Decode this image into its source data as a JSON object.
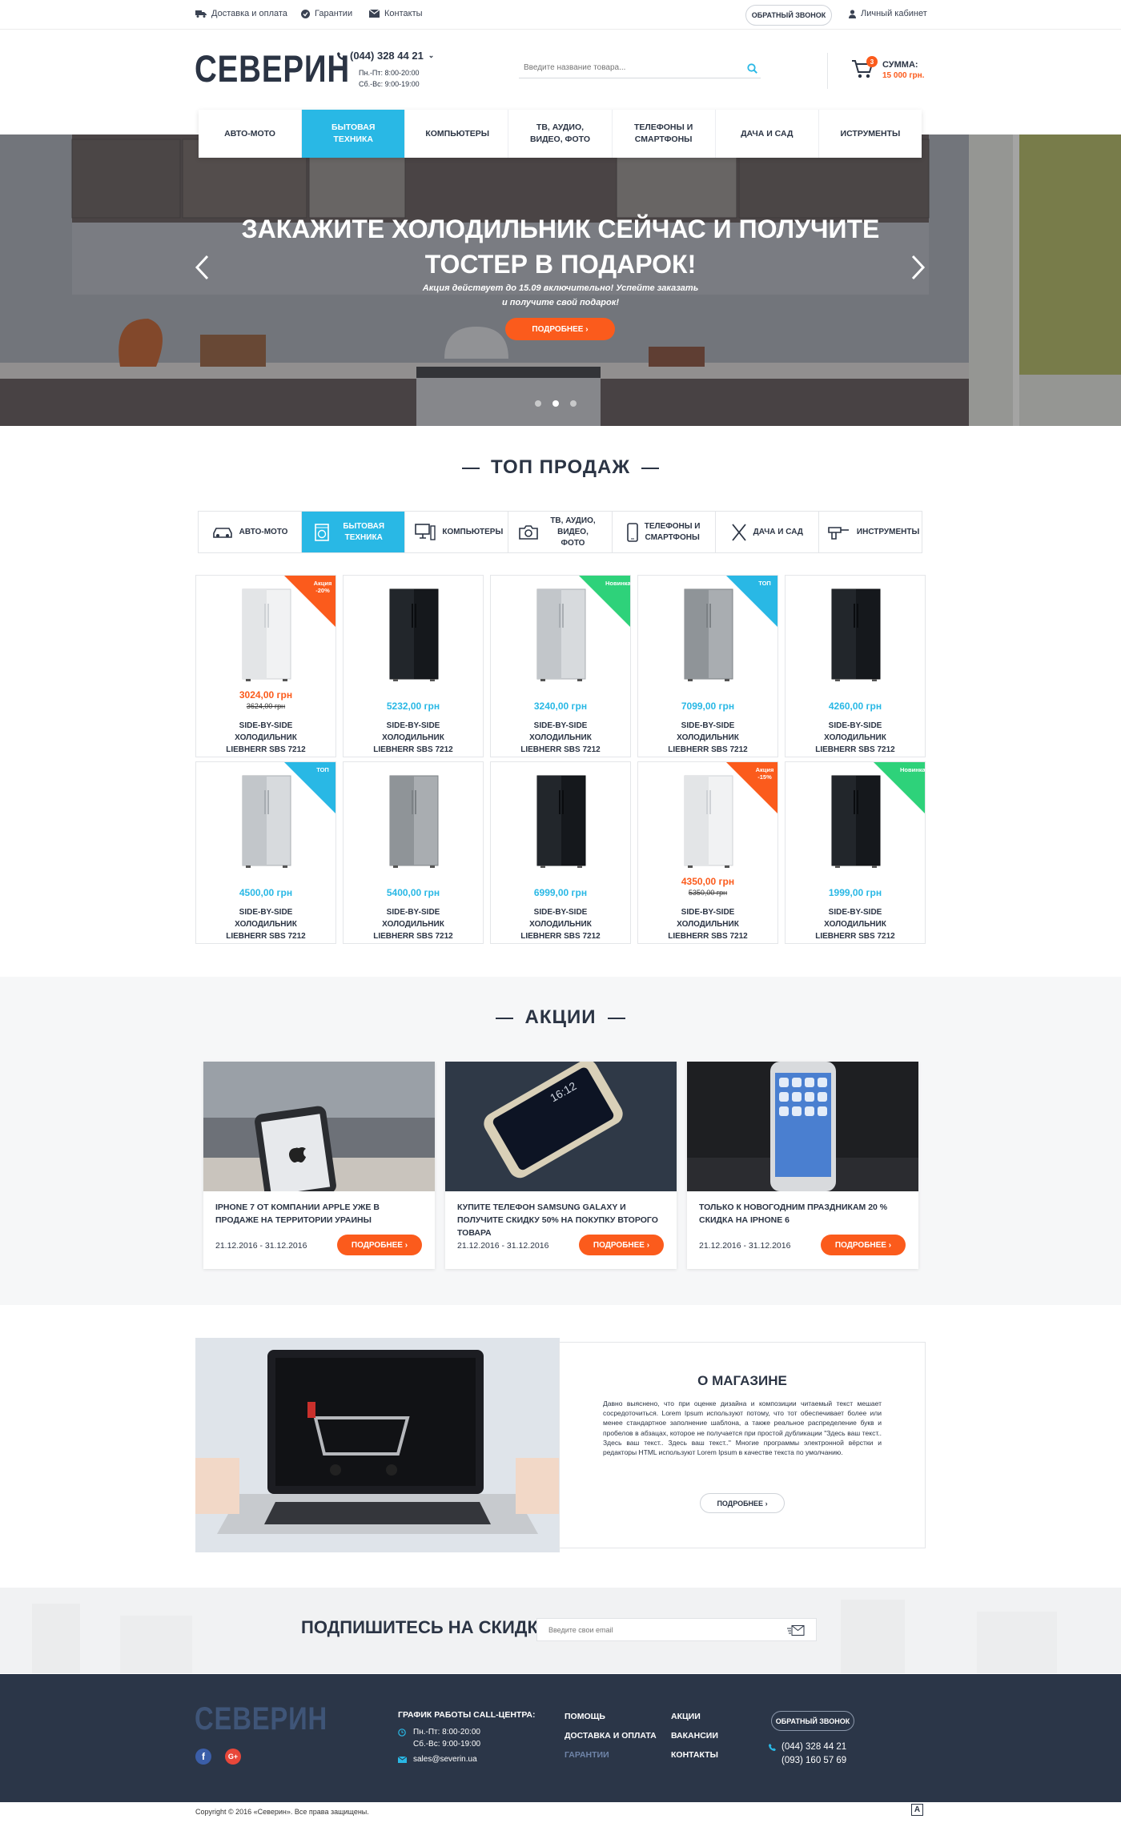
{
  "topbar": {
    "delivery": "Доставка и оплата",
    "guarantee": "Гарантии",
    "contacts": "Контакты",
    "callback": "Обратный звонок",
    "account": "Личный кабинет"
  },
  "header": {
    "logo": "СЕВЕРИН",
    "phone": "(044) 328 44 21",
    "hours_weekdays": "Пн.-Пт: 8:00-20:00",
    "hours_weekend": "Сб.-Вс: 9:00-19:00",
    "search_placeholder": "Введите название товара...",
    "cart_count": "3",
    "cart_label": "СУММА:",
    "cart_sum": "15 000 грн."
  },
  "nav": [
    {
      "label": "Авто-мото",
      "active": false
    },
    {
      "label": "Бытовая техника",
      "active": true
    },
    {
      "label": "Компьютеры",
      "active": false
    },
    {
      "label": "ТВ, Аудио, видео, фото",
      "active": false
    },
    {
      "label": "Телефоны и смартфоны",
      "active": false
    },
    {
      "label": "Дача и сад",
      "active": false
    },
    {
      "label": "Иструменты",
      "active": false
    }
  ],
  "hero": {
    "title_line1": "ЗАКАЖИТЕ ХОЛОДИЛЬНИК СЕЙЧАС И ПОЛУЧИТЕ",
    "title_line2": "ТОСТЕР В ПОДАРОК!",
    "sub_line1": "Акция действует до 15.09 включительно! Успейте заказать",
    "sub_line2": "и получите свой подарок!",
    "button": "Подробнее",
    "active_dot": 1,
    "dots": 3
  },
  "top_sales": {
    "title": "ТОП ПРОДАЖ",
    "tabs": [
      {
        "label": "Авто-мото",
        "icon": "car-icon",
        "active": false
      },
      {
        "label": "Бытовая техника",
        "icon": "washing-machine-icon",
        "active": true
      },
      {
        "label": "Компьютеры",
        "icon": "computer-icon",
        "active": false
      },
      {
        "label": "ТВ, аудио, видео, фото",
        "icon": "camera-icon",
        "active": false
      },
      {
        "label": "Телефоны и смартфоны",
        "icon": "phone-icon",
        "active": false
      },
      {
        "label": "Дача и сад",
        "icon": "garden-tools-icon",
        "active": false
      },
      {
        "label": "Инструменты",
        "icon": "drill-icon",
        "active": false
      }
    ],
    "products": [
      {
        "price": "3024,00 грн",
        "old": "3624,00 грн",
        "name": "SIDE-BY-SIDE ХОЛОДИЛЬНИК LIEBHERR SBS 7212",
        "badge": "Акция -20%",
        "badge_color": "#fb5b1c",
        "fridge": "white"
      },
      {
        "price": "5232,00 грн",
        "old": "",
        "name": "SIDE-BY-SIDE ХОЛОДИЛЬНИК LIEBHERR SBS 7212",
        "badge": "",
        "badge_color": "",
        "fridge": "black"
      },
      {
        "price": "3240,00 грн",
        "old": "",
        "name": "SIDE-BY-SIDE ХОЛОДИЛЬНИК LIEBHERR SBS 7212",
        "badge": "Новинка",
        "badge_color": "#2ed27a",
        "fridge": "silver"
      },
      {
        "price": "7099,00 грн",
        "old": "",
        "name": "SIDE-BY-SIDE ХОЛОДИЛЬНИК LIEBHERR SBS 7212",
        "badge": "ТОП",
        "badge_color": "#29b8e5",
        "fridge": "steel"
      },
      {
        "price": "4260,00 грн",
        "old": "",
        "name": "SIDE-BY-SIDE ХОЛОДИЛЬНИК LIEBHERR SBS 7212",
        "badge": "",
        "badge_color": "",
        "fridge": "black"
      },
      {
        "price": "4500,00 грн",
        "old": "",
        "name": "SIDE-BY-SIDE ХОЛОДИЛЬНИК LIEBHERR SBS 7212",
        "badge": "ТОП",
        "badge_color": "#29b8e5",
        "fridge": "silver"
      },
      {
        "price": "5400,00 грн",
        "old": "",
        "name": "SIDE-BY-SIDE ХОЛОДИЛЬНИК LIEBHERR SBS 7212",
        "badge": "",
        "badge_color": "",
        "fridge": "steel"
      },
      {
        "price": "6999,00 грн",
        "old": "",
        "name": "SIDE-BY-SIDE ХОЛОДИЛЬНИК LIEBHERR SBS 7212",
        "badge": "",
        "badge_color": "",
        "fridge": "black"
      },
      {
        "price": "4350,00 грн",
        "old": "5350,00 грн",
        "name": "SIDE-BY-SIDE ХОЛОДИЛЬНИК LIEBHERR SBS 7212",
        "badge": "Акция -15%",
        "badge_color": "#fb5b1c",
        "fridge": "white"
      },
      {
        "price": "1999,00 грн",
        "old": "",
        "name": "SIDE-BY-SIDE ХОЛОДИЛЬНИК LIEBHERR SBS 7212",
        "badge": "Новинка",
        "badge_color": "#2ed27a",
        "fridge": "black"
      }
    ]
  },
  "promos": {
    "title": "АКЦИИ",
    "items": [
      {
        "title": "IPHONE 7 ОТ КОМПАНИИ APPLE УЖЕ В ПРОДАЖЕ НА ТЕРРИТОРИИ УРАИНЫ",
        "dates": "21.12.2016 - 31.12.2016",
        "button": "Подробнее",
        "image": "iphone-apple"
      },
      {
        "title": "КУПИТЕ ТЕЛЕФОН SAMSUNG GALAXY И ПОЛУЧИТЕ СКИДКУ 50% НА ПОКУПКУ ВТОРОГО ТОВАРА",
        "dates": "21.12.2016 - 31.12.2016",
        "button": "Подробнее",
        "image": "samsung"
      },
      {
        "title": "ТОЛЬКО К НОВОГОДНИМ ПРАЗДНИКАМ 20 % СКИДКА НА IPHONE 6",
        "dates": "21.12.2016 - 31.12.2016",
        "button": "Подробнее",
        "image": "iphone-6"
      }
    ]
  },
  "about": {
    "title": "О МАГАЗИНЕ",
    "text": "Давно выяснено, что при оценке дизайна и композиции читаемый текст мешает сосредоточиться. Lorem Ipsum используют потому, что тот обеспечивает более или менее стандартное заполнение шаблона, а также реальное распределение букв и пробелов в абзацах, которое не получается при простой дубликации \"Здесь ваш текст.. Здесь ваш текст.. Здесь ваш текст..\" Многие программы электронной вёрстки и редакторы HTML используют Lorem Ipsum в качестве текста по умолчанию.",
    "button": "Подробнее"
  },
  "subscribe": {
    "title": "ПОДПИШИТЕСЬ НА СКИДКИ:",
    "placeholder": "Введите свои email"
  },
  "footer": {
    "logo": "СЕВЕРИН",
    "schedule_title": "ГРАФИК РАБОТЫ CALL-ЦЕНТРА:",
    "hours_weekdays": "Пн.-Пт: 8:00-20:00",
    "hours_weekend": "Сб.-Вс: 9:00-19:00",
    "email": "sales@severin.ua",
    "col1": [
      "ПОМОЩЬ",
      "ДОСТАВКА И ОПЛАТА",
      "ГАРАНТИИ"
    ],
    "col2": [
      "АКЦИИ",
      "ВАКАНСИИ",
      "КОНТАКТЫ"
    ],
    "callback": "Обратный звонок",
    "phone1": "(044) 328 44 21",
    "phone2": "(093) 160 57 69",
    "copyright": "Copyright © 2016 «Северин». Все права защищены."
  }
}
